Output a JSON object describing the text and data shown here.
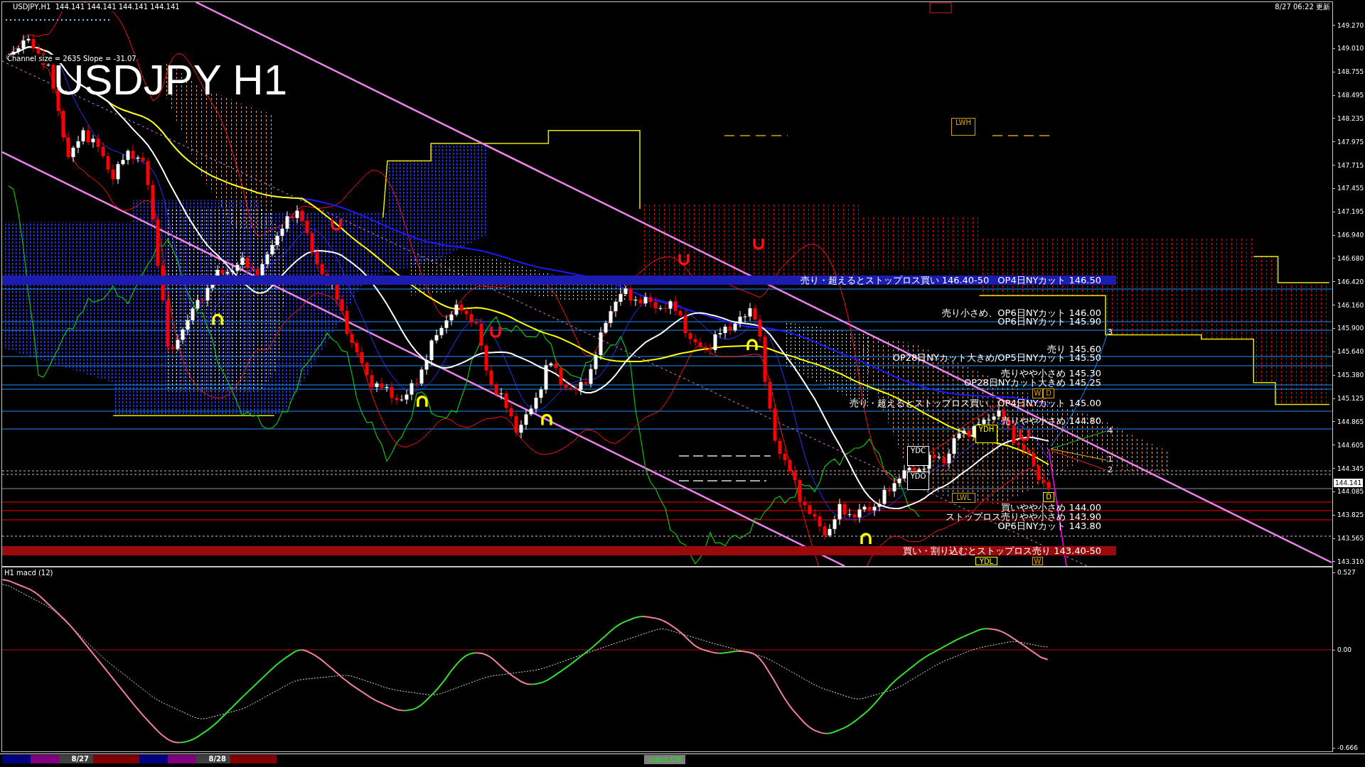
{
  "header": {
    "symbol": "USDJPY,H1",
    "prices": [
      "144.141",
      "144.141",
      "144.141",
      "144.141"
    ]
  },
  "updated": "8/27 06:22 更新",
  "title": "USDJPY H1",
  "channel_info": "Channel size = 2635 Slope = -31.07",
  "bands": [
    {
      "kind": "resistance",
      "notes": [
        "売り・超えるとストップロス買い 146.40-50",
        "OP4日NYカット 146.50"
      ]
    },
    {
      "kind": "support",
      "notes": [
        "買い・割り込むとストップロス売り 143.40-50"
      ]
    }
  ],
  "level_notes": [
    "売り小さめ、OP6日NYカット 146.00",
    "OP6日NYカット 145.90",
    "売り 145.60",
    "OP28日NYカット大きめ/OP5日NYカット 145.50",
    "売りやや小さめ 145.30",
    "OP28日NYカット大きめ 145.25",
    "売り・超えるとストップロス買い、OP4日NYカット 145.00",
    "売りやや小さめ 144.80",
    "買いやや小さめ 144.00",
    "ストップロス売りやや小さめ 143.90",
    "OP6日NYカット 143.80"
  ],
  "reference_boxes": [
    {
      "label": "LWH",
      "color": "#d4a017"
    },
    {
      "label": "W",
      "color": "#d4a017"
    },
    {
      "label": "D",
      "color": "#d4a017"
    },
    {
      "label": "YDH",
      "color": "#ffff00"
    },
    {
      "label": "YDC",
      "color": "#ffffff"
    },
    {
      "label": "YDO",
      "color": "#ffffff"
    },
    {
      "label": "LWL",
      "color": "#d4a017"
    },
    {
      "label": "D",
      "color": "#ffff00"
    },
    {
      "label": "YDL",
      "color": "#ffff00"
    },
    {
      "label": "W",
      "color": "#d4a017"
    }
  ],
  "wave_labels": [
    "3",
    "4",
    "1",
    "2"
  ],
  "price_axis": {
    "ticks": [
      "149.270",
      "149.010",
      "148.755",
      "148.495",
      "148.235",
      "147.975",
      "147.715",
      "147.455",
      "147.195",
      "146.940",
      "146.680",
      "146.420",
      "146.160",
      "145.900",
      "145.640",
      "145.380",
      "145.125",
      "144.865",
      "144.605",
      "144.345",
      "144.085",
      "143.825",
      "143.565",
      "143.310"
    ],
    "current_price": "144.141"
  },
  "macd": {
    "title": "H1 macd (12)",
    "ticks": [
      "0.527",
      "0.00",
      "-0.666"
    ]
  },
  "sessions": [
    {
      "color": "#000080"
    },
    {
      "color": "#800080"
    },
    {
      "label": "8/27",
      "color": "#404040"
    },
    {
      "color": "#800000"
    },
    {
      "color": "#000080"
    },
    {
      "color": "#800080"
    },
    {
      "label": "8/28",
      "color": "#404040"
    },
    {
      "color": "#800000"
    }
  ],
  "macd_button": "macd ON"
}
